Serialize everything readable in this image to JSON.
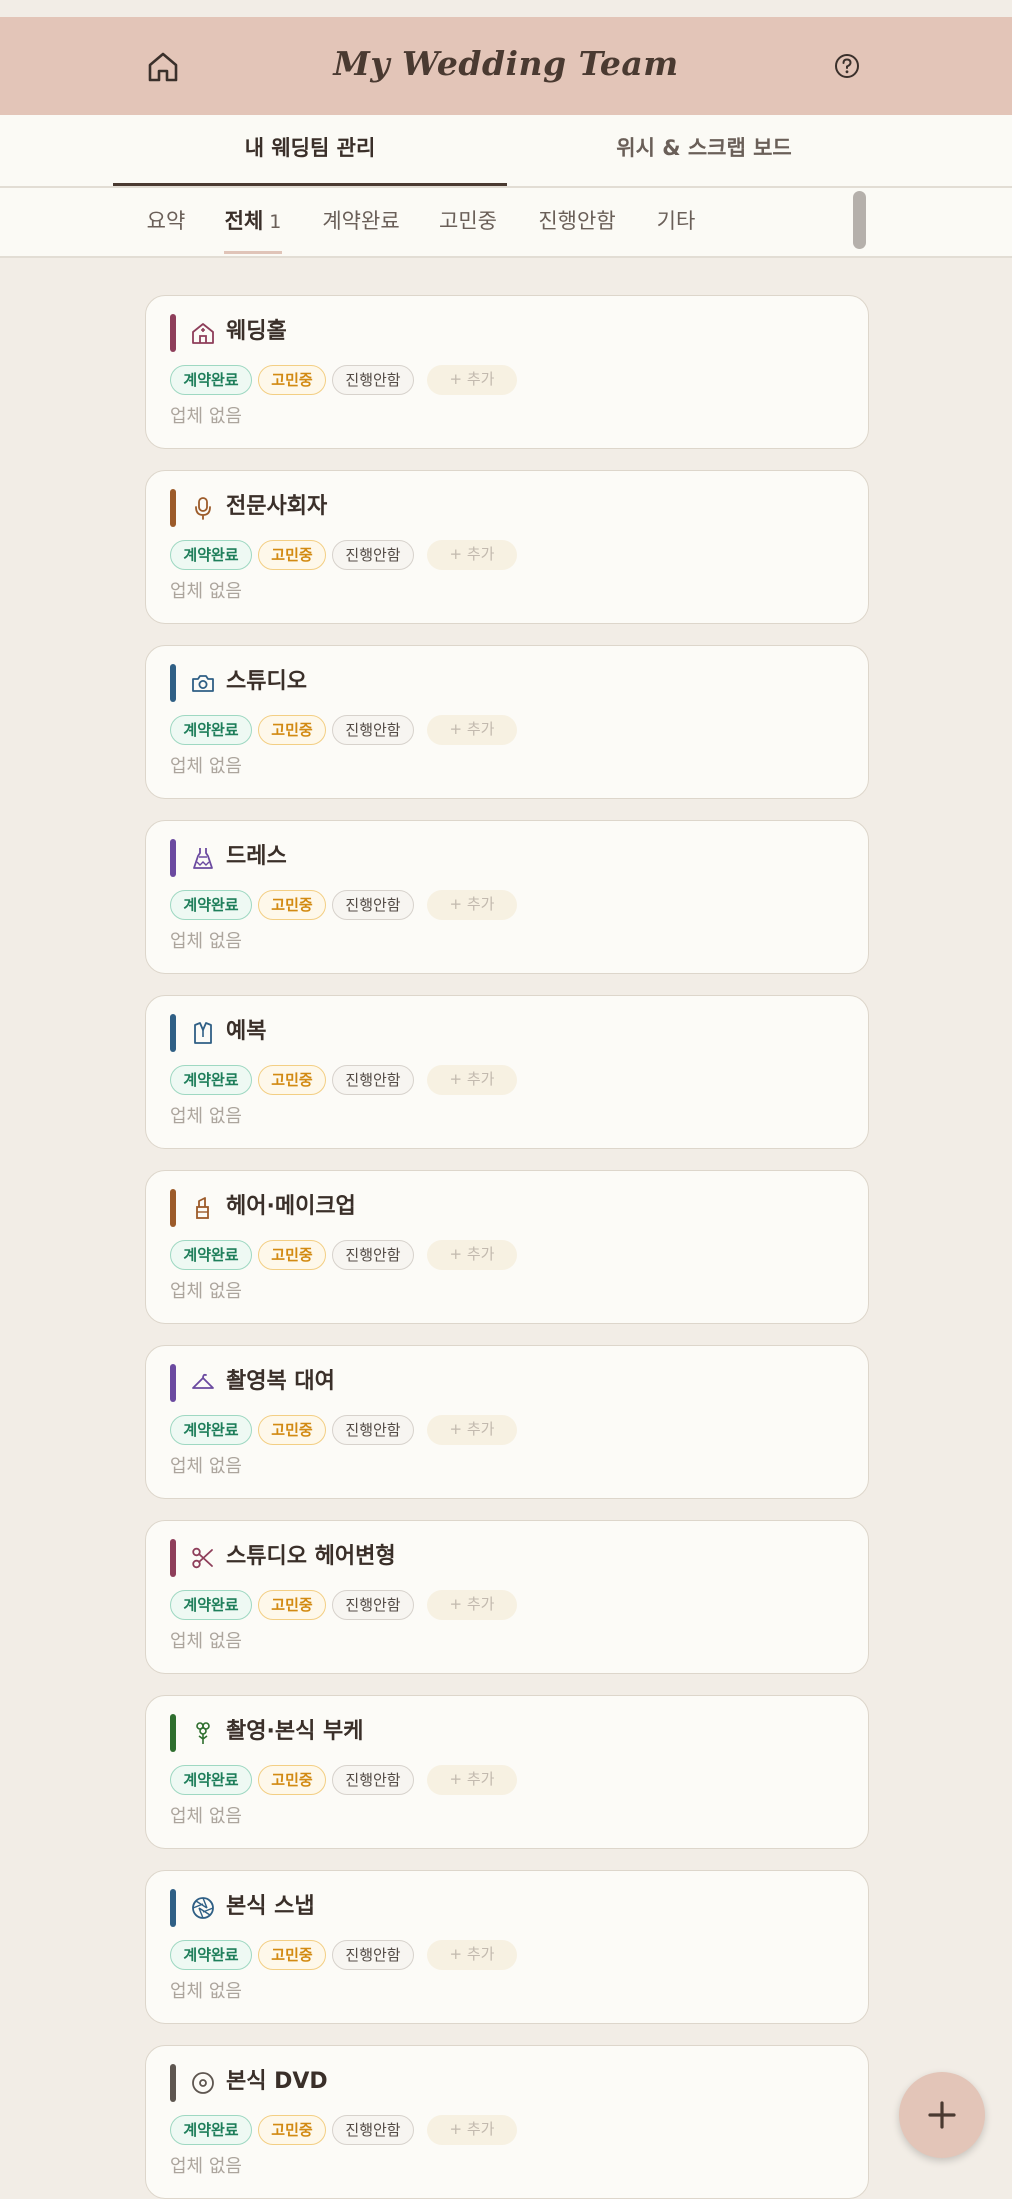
{
  "header": {
    "title": "My Wedding Team"
  },
  "main_tabs": [
    {
      "label": "내 웨딩팀 관리"
    },
    {
      "label": "위시 & 스크랩 보드"
    }
  ],
  "sub_tabs": [
    {
      "label": "요약"
    },
    {
      "label": "전체",
      "count": "1"
    },
    {
      "label": "계약완료"
    },
    {
      "label": "고민중"
    },
    {
      "label": "진행안함"
    },
    {
      "label": "기타"
    }
  ],
  "status_chips": {
    "contracted": "계약완료",
    "considering": "고민중",
    "not_proceeding": "진행안함",
    "add": "+ 추가"
  },
  "empty_text": "업체 없음",
  "categories": [
    {
      "name": "웨딩홀",
      "icon": "building-icon",
      "color": "#8e3e5a"
    },
    {
      "name": "전문사회자",
      "icon": "microphone-icon",
      "color": "#9c5b2a"
    },
    {
      "name": "스튜디오",
      "icon": "camera-icon",
      "color": "#2f5f85"
    },
    {
      "name": "드레스",
      "icon": "dress-icon",
      "color": "#6b4aa0"
    },
    {
      "name": "예복",
      "icon": "suit-icon",
      "color": "#2f5f85"
    },
    {
      "name": "헤어·메이크업",
      "icon": "lipstick-icon",
      "color": "#9c5b2a"
    },
    {
      "name": "촬영복 대여",
      "icon": "hanger-icon",
      "color": "#6b4aa0"
    },
    {
      "name": "스튜디오 헤어변형",
      "icon": "scissors-icon",
      "color": "#8e3e5a"
    },
    {
      "name": "촬영·본식 부케",
      "icon": "flower-icon",
      "color": "#2e6e2e"
    },
    {
      "name": "본식 스냅",
      "icon": "aperture-icon",
      "color": "#2f5f85"
    },
    {
      "name": "본식 DVD",
      "icon": "disc-icon",
      "color": "#5e5650"
    }
  ],
  "colors": {
    "header_bg": "#e3c5b8",
    "page_bg": "#f2ede6",
    "card_bg": "#fcfbf7"
  }
}
